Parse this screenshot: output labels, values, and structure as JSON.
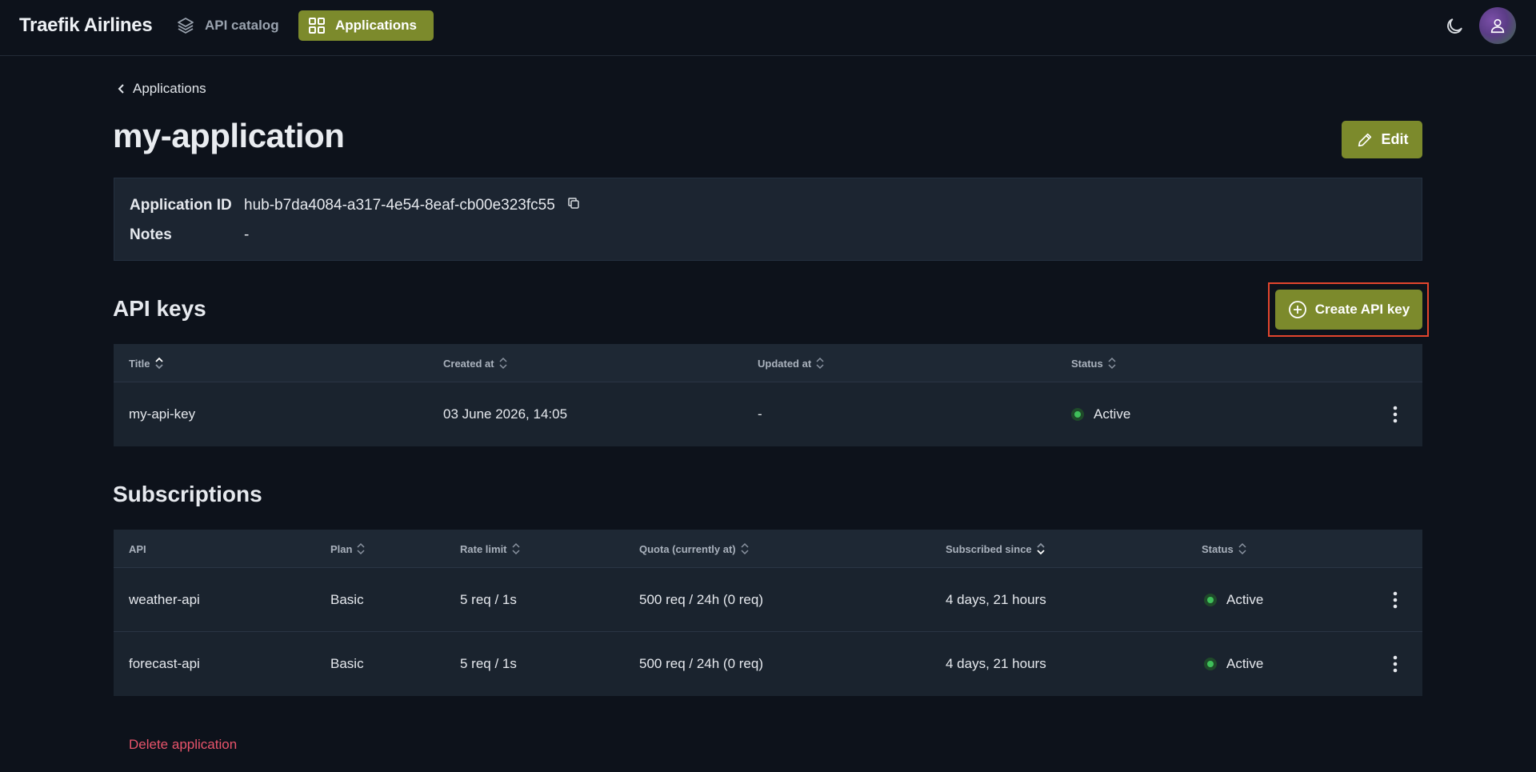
{
  "header": {
    "brand": "Traefik Airlines",
    "nav": [
      {
        "label": "API catalog",
        "icon": "layers-icon"
      },
      {
        "label": "Applications",
        "icon": "grid-icon"
      }
    ]
  },
  "breadcrumb": {
    "label": "Applications"
  },
  "page": {
    "title": "my-application",
    "edit_label": "Edit"
  },
  "info": {
    "app_id_label": "Application ID",
    "app_id_value": "hub-b7da4084-a317-4e54-8eaf-cb00e323fc55",
    "notes_label": "Notes",
    "notes_value": "-"
  },
  "api_keys": {
    "title": "API keys",
    "create_label": "Create API key",
    "columns": [
      "Title",
      "Created at",
      "Updated at",
      "Status"
    ],
    "rows": [
      {
        "title": "my-api-key",
        "created": "03 June 2026, 14:05",
        "updated": "-",
        "status": "Active"
      }
    ]
  },
  "subscriptions": {
    "title": "Subscriptions",
    "columns": [
      "API",
      "Plan",
      "Rate limit",
      "Quota (currently at)",
      "Subscribed since",
      "Status"
    ],
    "rows": [
      {
        "api": "weather-api",
        "plan": "Basic",
        "rate": "5 req / 1s",
        "quota": "500 req / 24h (0 req)",
        "since": "4 days, 21 hours",
        "status": "Active"
      },
      {
        "api": "forecast-api",
        "plan": "Basic",
        "rate": "5 req / 1s",
        "quota": "500 req / 24h (0 req)",
        "since": "4 days, 21 hours",
        "status": "Active"
      }
    ]
  },
  "delete_label": "Delete application",
  "colors": {
    "accent": "#7c8a2c",
    "background": "#0d121b",
    "danger": "#e9546b",
    "active": "#3fbf5a",
    "highlight": "#e2452d"
  }
}
